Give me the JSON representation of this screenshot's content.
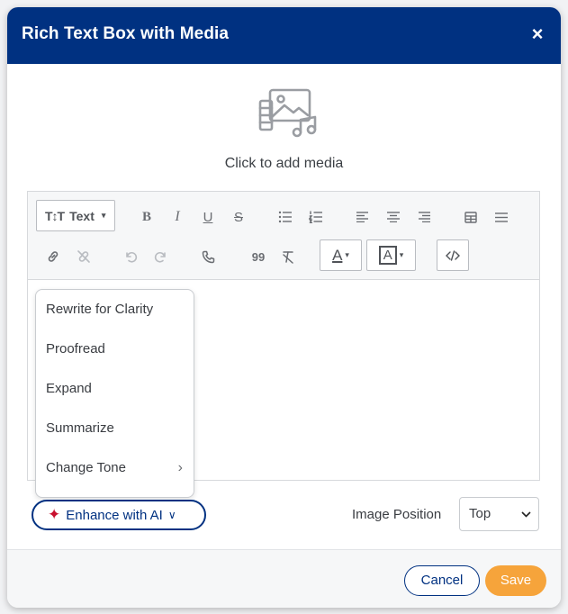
{
  "dialog": {
    "title": "Rich Text Box with Media",
    "close_label": "×"
  },
  "media": {
    "icon": "media-image-music-icon",
    "label": "Click to add media"
  },
  "toolbar": {
    "text_format": {
      "icon_label": "T↕T",
      "label": "Text",
      "caret": "▾"
    },
    "row1": [
      "bold-icon",
      "italic-icon",
      "underline-icon",
      "strikethrough-icon",
      "bulleted-list-icon",
      "numbered-list-icon",
      "align-left-icon",
      "align-center-icon",
      "align-right-icon",
      "table-icon",
      "justify-icon"
    ],
    "row2": [
      "link-icon",
      "unlink-icon",
      "undo-icon",
      "redo-icon",
      "phone-icon",
      "quote-icon",
      "clear-format-icon",
      "font-color-icon",
      "highlight-color-icon",
      "source-code-icon"
    ],
    "labels": {
      "bold": "B",
      "italic": "I",
      "underline": "U",
      "strike": "S",
      "quote": "99",
      "font_color": "A",
      "highlight": "A",
      "caret": "▾"
    }
  },
  "ai_menu": {
    "items": [
      {
        "label": "Rewrite for Clarity"
      },
      {
        "label": "Proofread"
      },
      {
        "label": "Expand"
      },
      {
        "label": "Summarize"
      },
      {
        "label": "Change Tone",
        "chevron": "›"
      }
    ]
  },
  "enhance": {
    "icon": "✦",
    "label": "Enhance with AI",
    "chevron": "∨"
  },
  "image_position": {
    "label": "Image Position",
    "value": "Top",
    "arrow": "⌄"
  },
  "footer": {
    "cancel_label": "Cancel",
    "save_label": "Save"
  },
  "colors": {
    "header_bg": "#003181",
    "accent": "#003181",
    "save_bg": "#f6a43b",
    "spark": "#c8102e"
  }
}
